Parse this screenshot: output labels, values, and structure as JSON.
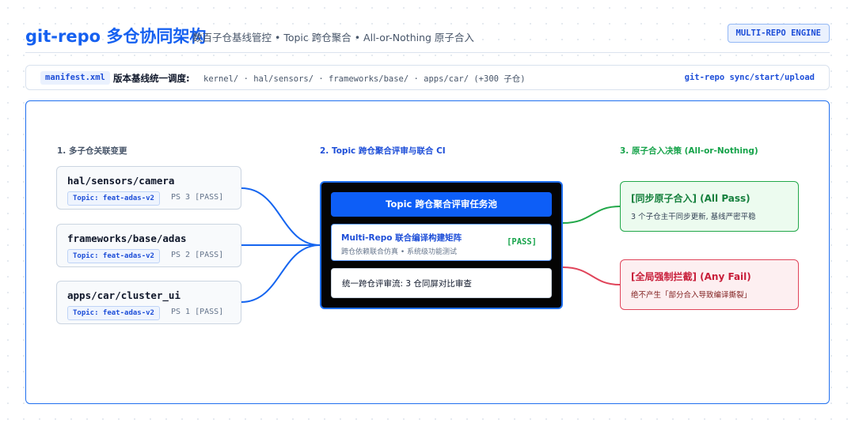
{
  "header": {
    "title": "git-repo 多仓协同架构",
    "subtitle": "数百子仓基线管控 • Topic 跨仓聚合 • All-or-Nothing 原子合入",
    "badge": "MULTI-REPO ENGINE"
  },
  "manifest": {
    "tag": "manifest.xml",
    "label": "版本基线统一调度:",
    "paths": "kernel/ · hal/sensors/ · frameworks/base/ · apps/car/ (+300 子仓)",
    "command": "git-repo sync/start/upload"
  },
  "sections": {
    "changes": "1. 多子仓关联变更",
    "review": "2. Topic 跨仓聚合评审与联合 CI",
    "decision": "3. 原子合入决策 (All-or-Nothing)"
  },
  "repos": [
    {
      "name": "hal/sensors/camera",
      "topic": "Topic: feat-adas-v2",
      "patchset": "PS 3 [PASS]"
    },
    {
      "name": "frameworks/base/adas",
      "topic": "Topic: feat-adas-v2",
      "patchset": "PS 2 [PASS]"
    },
    {
      "name": "apps/car/cluster_ui",
      "topic": "Topic: feat-adas-v2",
      "patchset": "PS 1 [PASS]"
    }
  ],
  "pool": {
    "header": "Topic 跨仓聚合评审任务池",
    "matrix_title": "Multi-Repo 联合编译构建矩阵",
    "matrix_subtitle": "跨仓依赖联合仿真 • 系统级功能测试",
    "matrix_status": "[PASS]",
    "review_stream": "统一跨仓评审流: 3 仓同屏对比审查"
  },
  "outcomes": {
    "pass": {
      "title": "[同步原子合入] (All Pass)",
      "description": "3 个子仓主干同步更新, 基线严密平稳"
    },
    "fail": {
      "title": "[全局强制拦截] (Any Fail)",
      "description": "绝不产生「部分合入导致编译撕裂」"
    }
  },
  "colors": {
    "accent": "#1f6fef",
    "pass": "#22a84a",
    "fail": "#e0445a",
    "pool_background": "#040404"
  }
}
